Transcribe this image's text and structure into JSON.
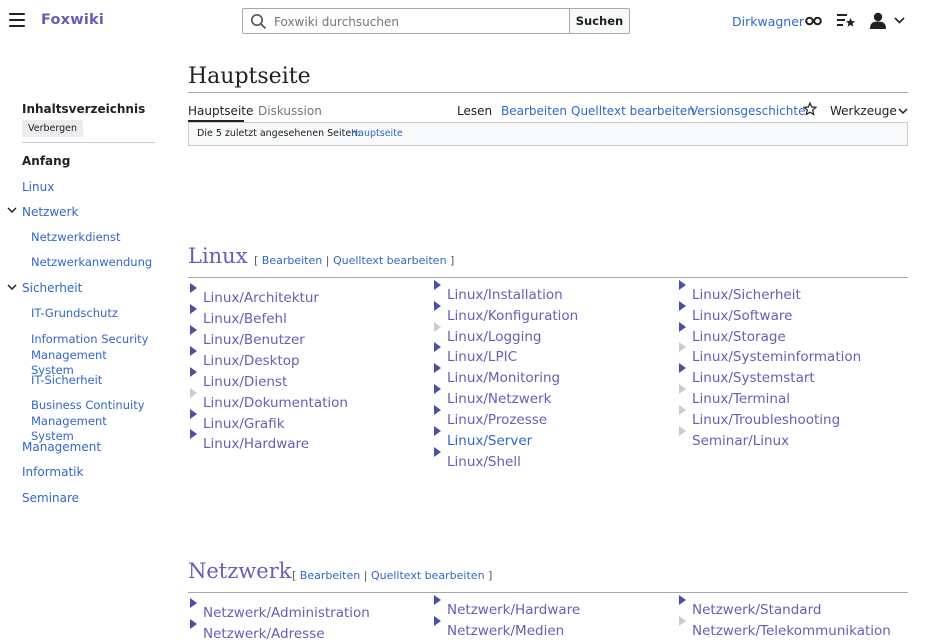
{
  "header": {
    "logo": "Foxwiki",
    "search_placeholder": "Foxwiki durchsuchen",
    "search_button": "Suchen",
    "username": "Dirkwagner"
  },
  "toc": {
    "title": "Inhaltsverzeichnis",
    "hide": "Verbergen",
    "items": [
      {
        "label": "Anfang"
      },
      {
        "label": "Linux"
      },
      {
        "label": "Netzwerk"
      },
      {
        "label": "Netzwerkdienst"
      },
      {
        "label": "Netzwerkanwendung"
      },
      {
        "label": "Sicherheit"
      },
      {
        "label": "IT-Grundschutz"
      },
      {
        "label": "Information Security Management System"
      },
      {
        "label": "IT-Sicherheit"
      },
      {
        "label": "Business Continuity Management System"
      },
      {
        "label": "Management"
      },
      {
        "label": "Informatik"
      },
      {
        "label": "Seminare"
      }
    ]
  },
  "page": {
    "title": "Hauptseite",
    "tabs": [
      "Hauptseite",
      "Diskussion"
    ],
    "actions": [
      "Lesen",
      "Bearbeiten",
      "Quelltext bearbeiten",
      "Versionsgeschichte",
      "Werkzeuge"
    ],
    "recent_label": "Die 5 zuletzt angesehenen Seiten:",
    "recent_link": "Hauptseite"
  },
  "sections": {
    "edit_open": "[",
    "edit_label": "Bearbeiten",
    "edit_sep": "|",
    "edit_source": "Quelltext bearbeiten",
    "edit_close": "]",
    "linux": {
      "title": "Linux",
      "col1": [
        "Linux/Architektur",
        "Linux/Befehl",
        "Linux/Benutzer",
        "Linux/Desktop",
        "Linux/Dienst",
        "Linux/Dokumentation",
        "Linux/Grafik",
        "Linux/Hardware"
      ],
      "col2": [
        "Linux/Installation",
        "Linux/Konfiguration",
        "Linux/Logging",
        "Linux/LPIC",
        "Linux/Monitoring",
        "Linux/Netzwerk",
        "Linux/Prozesse",
        "Linux/Server",
        "Linux/Shell"
      ],
      "col3": [
        "Linux/Sicherheit",
        "Linux/Software",
        "Linux/Storage",
        "Linux/Systeminformation",
        "Linux/Systemstart",
        "Linux/Terminal",
        "Linux/Troubleshooting",
        "Seminar/Linux"
      ]
    },
    "netzwerk": {
      "title": "Netzwerk",
      "col1": [
        "Netzwerk/Administration",
        "Netzwerk/Adresse"
      ],
      "col2": [
        "Netzwerk/Hardware",
        "Netzwerk/Medien"
      ],
      "col3": [
        "Netzwerk/Standard",
        "Netzwerk/Telekommunikation"
      ]
    }
  },
  "colors": {
    "accent": "#6a5cb8",
    "link": "#3366cc",
    "text": "#202122"
  }
}
